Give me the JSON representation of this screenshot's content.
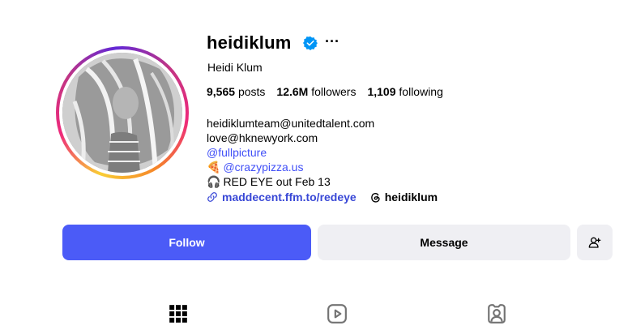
{
  "profile": {
    "username": "heidiklum",
    "full_name": "Heidi Klum",
    "more_label": "···"
  },
  "stats": {
    "posts_count": "9,565",
    "posts_label": "posts",
    "followers_count": "12.6M",
    "followers_label": "followers",
    "following_count": "1,109",
    "following_label": "following"
  },
  "bio": {
    "line1": "heidiklumteam@unitedtalent.com",
    "line2": "love@hknewyork.com",
    "mention1": "@fullpicture",
    "mention2_emoji": "🍕",
    "mention2": "@crazypizza.us",
    "line5_emoji": "🎧",
    "line5": "RED EYE out Feb 13"
  },
  "links": {
    "url": "maddecent.ffm.to/redeye",
    "threads_handle": "heidiklum"
  },
  "buttons": {
    "follow": "Follow",
    "message": "Message"
  },
  "colors": {
    "follow_button": "#4b5bf7",
    "link": "#3847d6",
    "verified": "#0095f6"
  },
  "icons": [
    "verified-badge-icon",
    "link-icon",
    "threads-icon",
    "add-user-icon",
    "grid-icon",
    "reels-icon",
    "tagged-icon"
  ]
}
